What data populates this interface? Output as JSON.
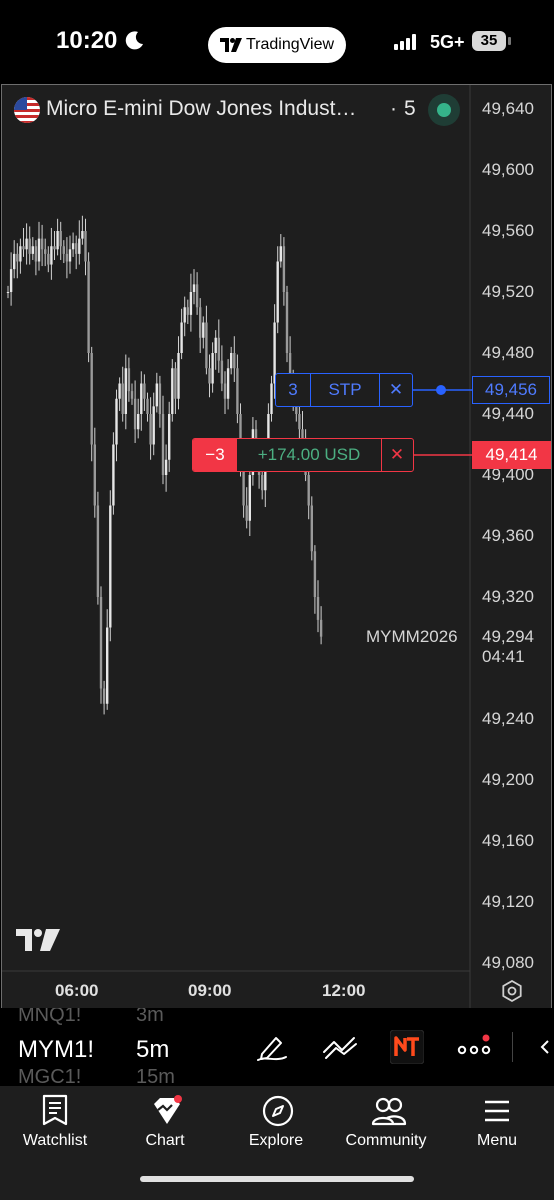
{
  "status_bar": {
    "time": "10:20",
    "app_pill": "TradingView",
    "network": "5G+",
    "battery": "35"
  },
  "chart": {
    "title": "Micro E-mini Dow Jones Indust…",
    "separator": "·",
    "interval": "5",
    "symbol_label": "MYMM2026",
    "last_price": "49,294",
    "countdown": "04:41",
    "colors": {
      "background": "#1e1e1e",
      "candles": "#d0d0d0",
      "stop_order": "#2962ff",
      "position": "#f23645",
      "profit_text": "#4caf82"
    },
    "stop_order": {
      "qty": "3",
      "type": "STP",
      "close": "✕",
      "price": "49,456"
    },
    "position": {
      "qty": "−3",
      "pnl": "+174.00 USD",
      "close": "✕",
      "price": "49,414"
    }
  },
  "chart_data": {
    "type": "candlestick",
    "y_axis_ticks": [
      "49,640",
      "49,600",
      "49,560",
      "49,520",
      "49,480",
      "49,440",
      "49,400",
      "49,360",
      "49,320",
      "49,240",
      "49,200",
      "49,160",
      "49,120",
      "49,080"
    ],
    "x_axis_ticks": [
      "06:00",
      "09:00",
      "12:00"
    ],
    "ylim": [
      49070,
      49650
    ],
    "close_series": [
      49520,
      49535,
      49545,
      49540,
      49550,
      49548,
      49555,
      49545,
      49550,
      49540,
      49555,
      49548,
      49545,
      49538,
      49550,
      49548,
      49560,
      49550,
      49545,
      49540,
      49548,
      49552,
      49545,
      49555,
      49560,
      49540,
      49480,
      49420,
      49380,
      49320,
      49260,
      49250,
      49300,
      49380,
      49420,
      49450,
      49460,
      49440,
      49470,
      49455,
      49450,
      49430,
      49440,
      49460,
      49450,
      49440,
      49420,
      49445,
      49460,
      49440,
      49400,
      49410,
      49440,
      49470,
      49450,
      49480,
      49500,
      49510,
      49505,
      49520,
      49525,
      49510,
      49490,
      49500,
      49470,
      49460,
      49480,
      49490,
      49475,
      49460,
      49450,
      49470,
      49480,
      49470,
      49440,
      49410,
      49380,
      49370,
      49400,
      49430,
      49420,
      49400,
      49390,
      49410,
      49440,
      49460,
      49500,
      49540,
      49550,
      49520,
      49480,
      49460,
      49450,
      49440,
      49430,
      49420,
      49400,
      49380,
      49350,
      49320,
      49305,
      49294
    ]
  },
  "toolbar": {
    "prev_symbol": "MNQ1!",
    "prev_interval": "3m",
    "symbol": "MYM1!",
    "interval": "5m",
    "next_symbol": "MGC1!",
    "next_interval": "15m"
  },
  "tabs": [
    {
      "label": "Watchlist"
    },
    {
      "label": "Chart"
    },
    {
      "label": "Explore"
    },
    {
      "label": "Community"
    },
    {
      "label": "Menu"
    }
  ]
}
